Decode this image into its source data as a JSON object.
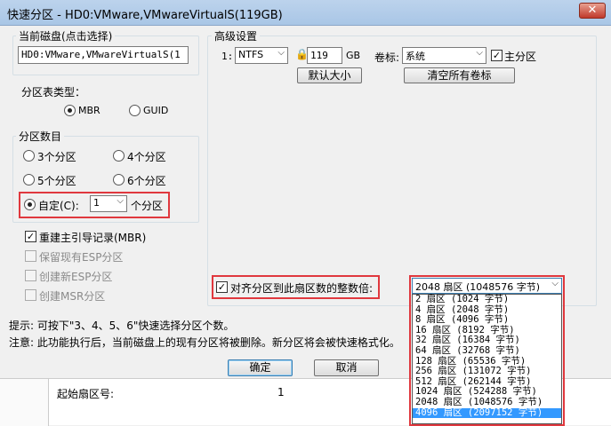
{
  "window": {
    "title": "快速分区 - HD0:VMware,VMwareVirtualS(119GB)",
    "close_label": "✕"
  },
  "disk_group": {
    "legend": "当前磁盘(点击选择)",
    "disk_value": "HD0:VMware,VMwareVirtualS(1"
  },
  "partition_table": {
    "label": "分区表类型：",
    "mbr_label": "MBR",
    "guid_label": "GUID",
    "selected": "MBR"
  },
  "partition_count": {
    "legend": "分区数目",
    "options": [
      "3个分区",
      "4个分区",
      "5个分区",
      "6个分区"
    ],
    "custom_label": "自定(C):",
    "custom_value": "1",
    "custom_suffix": "个分区"
  },
  "options": {
    "rebuild_mbr": "重建主引导记录(MBR)",
    "keep_esp": "保留现有ESP分区",
    "create_esp": "创建新ESP分区",
    "create_msr": "创建MSR分区"
  },
  "advanced": {
    "legend": "高级设置",
    "row_index": "1:",
    "fs_value": "NTFS",
    "size_value": "119",
    "size_unit": "GB",
    "volume_label_text": "卷标:",
    "volume_label_value": "系统",
    "primary_label": "主分区",
    "default_size_button": "默认大小",
    "clear_labels_button": "清空所有卷标"
  },
  "align": {
    "checkbox_label": "对齐分区到此扇区数的整数倍:",
    "selected_value": "2048 扇区 (1048576 字节)",
    "options": [
      "2 扇区 (1024 字节)",
      "4 扇区 (2048 字节)",
      "8 扇区 (4096 字节)",
      "16 扇区 (8192 字节)",
      "32 扇区 (16384 字节)",
      "64 扇区 (32768 字节)",
      "128 扇区 (65536 字节)",
      "256 扇区 (131072 字节)",
      "512 扇区 (262144 字节)",
      "1024 扇区 (524288 字节)",
      "2048 扇区 (1048576 字节)",
      "4096 扇区 (2097152 字节)"
    ],
    "highlighted_index": 11
  },
  "notes": {
    "tip": "提示: 可按下\"3、4、5、6\"快速选择分区个数。",
    "warning": "注意: 此功能执行后，当前磁盘上的现有分区将被删除。新分区将会被快速格式化。"
  },
  "buttons": {
    "ok": "确定",
    "cancel": "取消"
  },
  "background": {
    "row_label": "起始扇区号:",
    "row_value": "1"
  }
}
